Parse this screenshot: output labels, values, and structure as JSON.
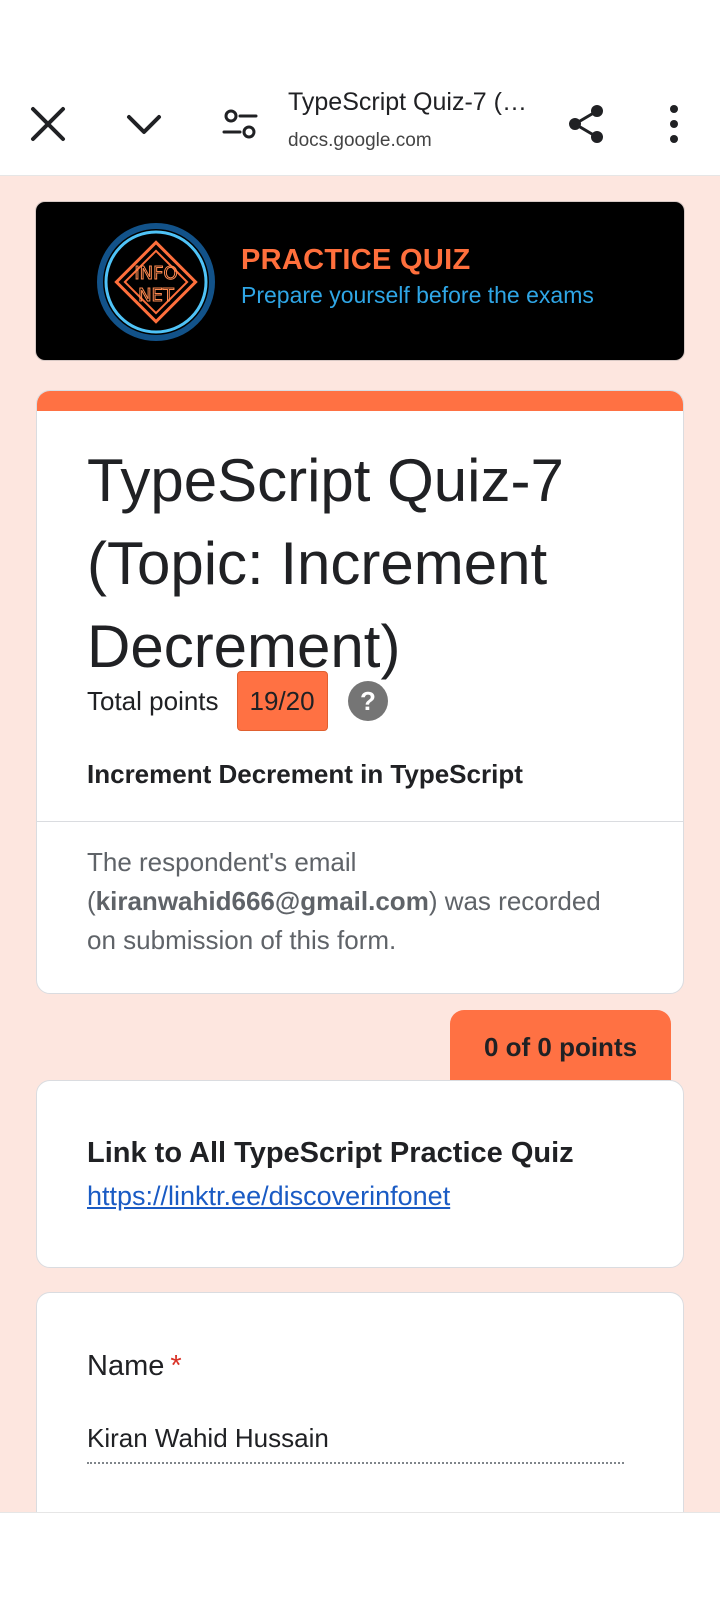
{
  "browser": {
    "title": "TypeScript Quiz-7 (…",
    "url": "docs.google.com"
  },
  "banner": {
    "logo_text_line1": "INFO",
    "logo_text_line2": "NET",
    "title": "PRACTICE QUIZ",
    "subtitle": "Prepare yourself before the exams"
  },
  "form": {
    "title": "TypeScript Quiz-7 (Topic:  Increment Decrement)",
    "total_points_label": "Total points",
    "score": "19/20",
    "description": "Increment Decrement in TypeScript",
    "email_note_prefix": "The respondent's email (",
    "email": "kiranwahid666@gmail.com",
    "email_note_suffix": ") was recorded on submission of this form."
  },
  "section": {
    "points": "0 of 0 points",
    "link_title": "Link to All TypeScript Practice Quiz",
    "link_url": "https://linktr.ee/discoverinfonet"
  },
  "question": {
    "label": "Name",
    "required_mark": "*",
    "answer": "Kiran Wahid Hussain"
  },
  "colors": {
    "accent": "#ff7143",
    "background": "#fde6df",
    "link": "#1a5bc4",
    "banner_title": "#ff6f3c",
    "banner_subtitle": "#2fa6e6"
  },
  "icons": [
    "close-icon",
    "chevron-down-icon",
    "tune-icon",
    "share-icon",
    "more-vert-icon",
    "help-icon",
    "feedback-icon"
  ]
}
